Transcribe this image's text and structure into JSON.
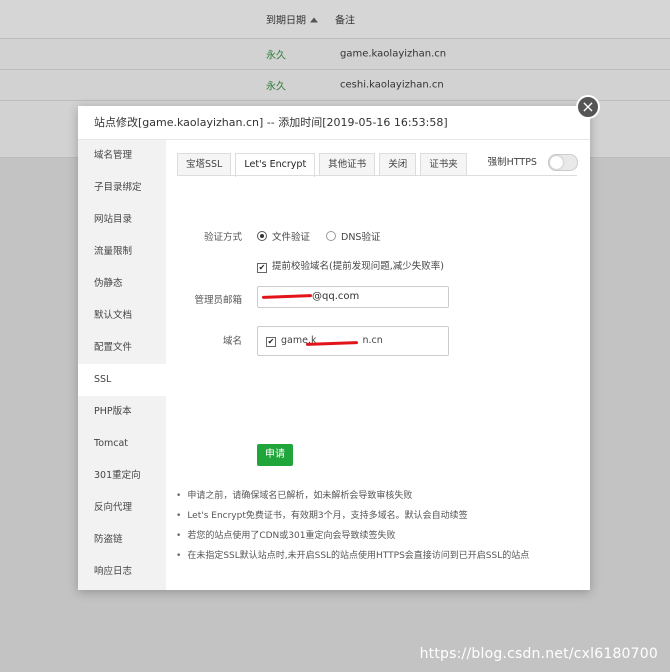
{
  "background": {
    "headers": {
      "expire": "到期日期",
      "note": "备注"
    },
    "rows": [
      {
        "expire": "永久",
        "note": "game.kaolayizhan.cn"
      },
      {
        "expire": "永久",
        "note": "ceshi.kaolayizhan.cn"
      }
    ]
  },
  "modal": {
    "title": "站点修改[game.kaolayizhan.cn] -- 添加时间[2019-05-16 16:53:58]",
    "close_label": "×",
    "sidebar": [
      "域名管理",
      "子目录绑定",
      "网站目录",
      "流量限制",
      "伪静态",
      "默认文档",
      "配置文件",
      "SSL",
      "PHP版本",
      "Tomcat",
      "301重定向",
      "反向代理",
      "防盗链",
      "响应日志"
    ],
    "active_sidebar": "SSL",
    "tabs": [
      "宝塔SSL",
      "Let's Encrypt",
      "其他证书",
      "关闭",
      "证书夹"
    ],
    "active_tab": "Let's Encrypt",
    "force_https_label": "强制HTTPS",
    "force_https_on": false,
    "verify": {
      "label": "验证方式",
      "options": [
        "文件验证",
        "DNS验证"
      ],
      "selected": "文件验证"
    },
    "precheck_label": "提前校验域名(提前发现问题,减少失败率)",
    "precheck_checked": true,
    "email": {
      "label": "管理员邮箱",
      "value": "@qq.com"
    },
    "domain": {
      "label": "域名",
      "value": "game.k",
      "value_tail": "n.cn",
      "checked": true
    },
    "apply_label": "申请",
    "tips": [
      "申请之前，请确保域名已解析，如未解析会导致审核失败",
      "Let's Encrypt免费证书，有效期3个月，支持多域名。默认会自动续签",
      "若您的站点使用了CDN或301重定向会导致续签失败",
      "在未指定SSL默认站点时,未开启SSL的站点使用HTTPS会直接访问到已开启SSL的站点"
    ]
  },
  "watermark": "https://blog.csdn.net/cxl6180700",
  "colors": {
    "accent_green": "#20a53a",
    "scribble_red": "#e2141a"
  }
}
